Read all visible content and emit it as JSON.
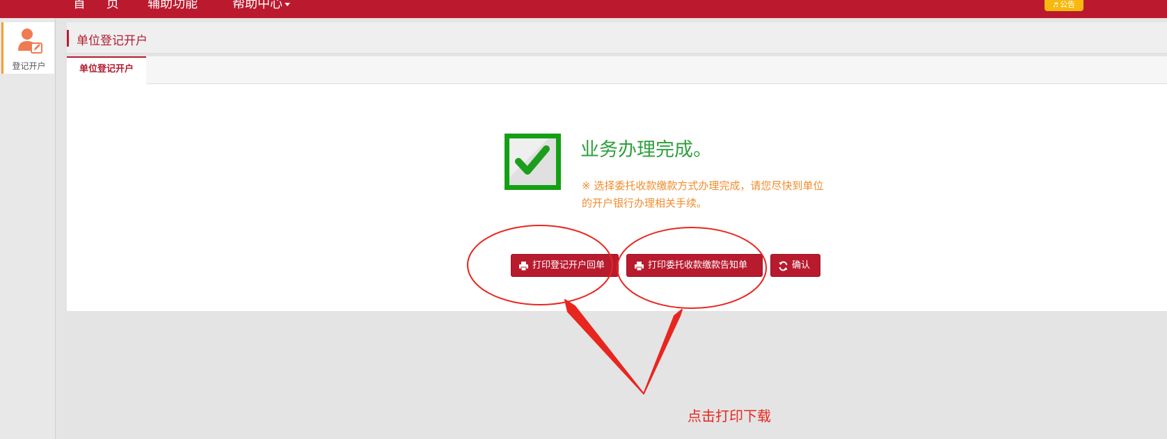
{
  "nav": {
    "home": "首 页",
    "aux": "辅助功能",
    "help": "帮助中心",
    "notice": "公告"
  },
  "sidebar": {
    "item_label": "登记开户",
    "item_icon": "user-edit-icon"
  },
  "page": {
    "title": "单位登记开户",
    "tab": "单位登记开户"
  },
  "result": {
    "title": "业务办理完成。",
    "note": "※ 选择委托收款缴款方式办理完成，请您尽快到单位的开户银行办理相关手续。"
  },
  "buttons": {
    "print_receipt": "打印登记开户回单",
    "print_notice": "打印委托收款缴款告知单",
    "confirm": "确认"
  },
  "annotation": {
    "text": "点击打印下载",
    "color": "#e8261f"
  },
  "colors": {
    "brand": "#bb1a2e",
    "success": "#2ea03c",
    "note": "#f08c2e",
    "notice_badge": "#f7b90f"
  }
}
